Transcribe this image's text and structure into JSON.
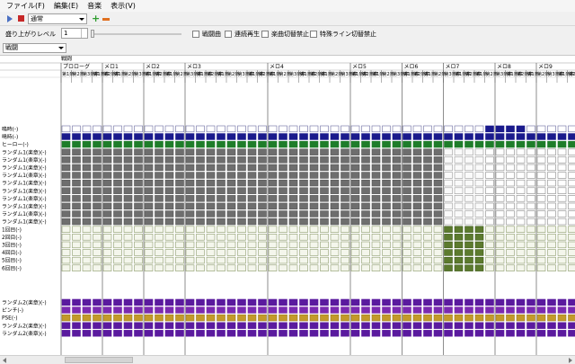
{
  "menu": [
    "ファイル(F)",
    "編集(E)",
    "音楽",
    "表示(V)"
  ],
  "toolbar": {
    "mode_value": "通常",
    "add_icon": "plus-icon",
    "remove_icon": "minus-icon"
  },
  "options": {
    "level_label": "盛り上がりレベル",
    "level_value": "1",
    "checkboxes": [
      "戦闘曲",
      "連続再生",
      "楽曲切替禁止",
      "特殊ライン切替禁止"
    ]
  },
  "section_select": "戦闘",
  "header": {
    "group_title": "戦闘",
    "sections": [
      "プロローグ",
      "メロ1",
      "メロ2",
      "メロ3",
      "メロ4",
      "メロ5",
      "メロ6",
      "メロ7",
      "メロ8",
      "メロ9"
    ],
    "sub_labels": [
      "第1楽",
      "第2楽",
      "第3楽章",
      "第1楽章",
      "第2楽章"
    ]
  },
  "tracks": [
    "鳴時(-)",
    "鳴時(-)",
    "ヒーロー(-)",
    "ランダム1(楽章)(-)",
    "ランダム1(楽章)(-)",
    "ランダム1(楽章)(-)",
    "ランダム1(楽章)(-)",
    "ランダム1(楽章)(-)",
    "ランダム1(楽章)(-)",
    "ランダム1(楽章)(-)",
    "ランダム1(楽章)(-)",
    "ランダム1(楽章)(-)",
    "ランダム1(楽章)(-)",
    "1回目(-)",
    "2回目(-)",
    "3回目(-)",
    "4回目(-)",
    "5回目(-)",
    "6回目(-)",
    "ランダム2(楽章)(-)",
    "ピンチ(-)",
    "PSE(-)",
    "ランダム2(楽章)(-)",
    "ランダム2(楽章)(-)"
  ],
  "colors": {
    "navy": "#1a1a8c",
    "green": "#1e7d2a",
    "gray": "#6e6e6e",
    "olive": "#5c7a2e",
    "purple": "#5a1a9e",
    "magenta": "#7a2ab0",
    "gold": "#c39a2a",
    "empty_border": "#6a6aa0",
    "light_fill": "#f4f6ec"
  }
}
